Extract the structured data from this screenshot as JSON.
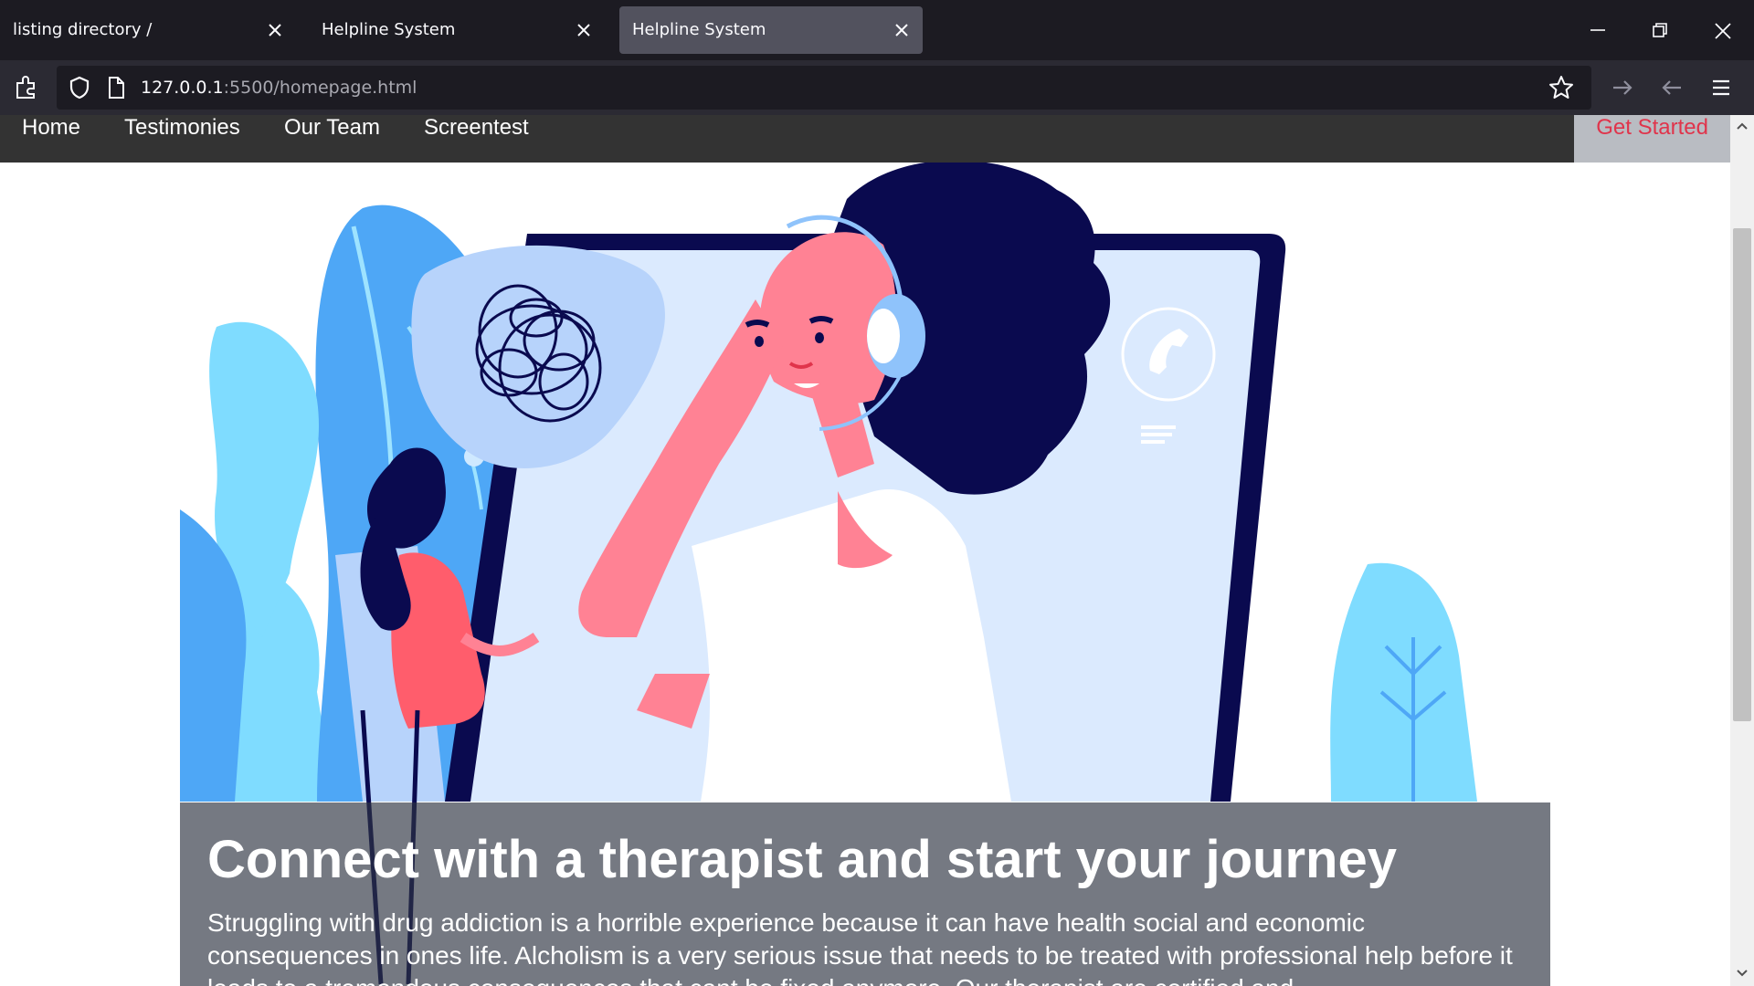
{
  "browser": {
    "tabs": [
      {
        "title": "listing directory /",
        "active": false
      },
      {
        "title": "Helpline System",
        "active": false
      },
      {
        "title": "Helpline System",
        "active": true
      }
    ],
    "url_host": "127.0.0.1",
    "url_rest": ":5500/homepage.html",
    "window_controls": [
      "minimize-icon",
      "restore-icon",
      "close-icon"
    ],
    "toolbar_icons": [
      "extensions-icon",
      "shield-icon",
      "page-icon",
      "star-icon",
      "forward-icon",
      "back-icon",
      "menu-icon"
    ]
  },
  "site": {
    "nav": [
      "Home",
      "Testimonies",
      "Our Team",
      "Screentest"
    ],
    "cta": "Get Started",
    "cta_color": "#e0344b",
    "nav_bg": "#333333"
  },
  "hero": {
    "illustration": "therapist-with-headset-and-client-illustration",
    "title": "Connect with a therapist and start your journey",
    "text": "Struggling with drug addiction is a horrible experience because it can have health social and economic consequences in ones life. Alcholism is a very serious issue that needs to be treated with professional help before it leads to a tremendous consequences that cant be fixed anymore. Our therapist are certified and"
  }
}
